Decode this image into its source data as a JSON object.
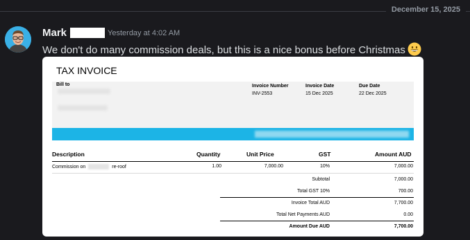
{
  "chat": {
    "date_divider": "December 15, 2025",
    "author": "Mark",
    "timestamp": "Yesterday at 4:02 AM",
    "message": "We don't do many commission deals, but this is a nice bonus before Christmas",
    "emoji": "grinning-face-emoji"
  },
  "invoice": {
    "title": "TAX INVOICE",
    "bill_to_label": "Bill to",
    "invoice_number_label": "Invoice Number",
    "invoice_number": "INV-2553",
    "invoice_date_label": "Invoice Date",
    "invoice_date": "15 Dec 2025",
    "due_date_label": "Due Date",
    "due_date": "22 Dec 2025",
    "columns": {
      "description": "Description",
      "quantity": "Quantity",
      "unit_price": "Unit Price",
      "gst": "GST",
      "amount": "Amount AUD"
    },
    "line_item": {
      "desc_prefix": "Commission on",
      "desc_suffix": "re-roof",
      "quantity": "1.00",
      "unit_price": "7,000.00",
      "gst": "10%",
      "amount": "7,000.00"
    },
    "totals": {
      "subtotal_label": "Subtotal",
      "subtotal": "7,000.00",
      "gst_label": "Total GST 10%",
      "gst": "700.00",
      "invoice_total_label": "Invoice Total AUD",
      "invoice_total": "7,700.00",
      "payments_label": "Total Net Payments AUD",
      "payments": "0.00",
      "amount_due_label": "Amount Due AUD",
      "amount_due": "7,700.00"
    }
  },
  "colors": {
    "background": "#1a1a1e",
    "accent_bar": "#1cb4e6",
    "avatar_bg": "#3ab0e6"
  }
}
